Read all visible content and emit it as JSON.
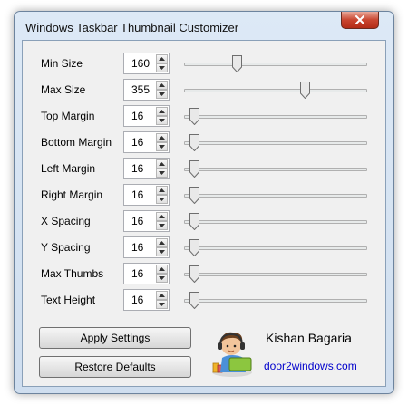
{
  "window": {
    "title": "Windows Taskbar Thumbnail Customizer"
  },
  "settings": [
    {
      "label": "Min Size",
      "value": "160",
      "slider_fraction": 0.28
    },
    {
      "label": "Max Size",
      "value": "355",
      "slider_fraction": 0.67
    },
    {
      "label": "Top Margin",
      "value": "16",
      "slider_fraction": 0.03
    },
    {
      "label": "Bottom Margin",
      "value": "16",
      "slider_fraction": 0.03
    },
    {
      "label": "Left Margin",
      "value": "16",
      "slider_fraction": 0.03
    },
    {
      "label": "Right Margin",
      "value": "16",
      "slider_fraction": 0.03
    },
    {
      "label": "X Spacing",
      "value": "16",
      "slider_fraction": 0.03
    },
    {
      "label": "Y Spacing",
      "value": "16",
      "slider_fraction": 0.03
    },
    {
      "label": "Max Thumbs",
      "value": "16",
      "slider_fraction": 0.03
    },
    {
      "label": "Text Height",
      "value": "16",
      "slider_fraction": 0.03
    }
  ],
  "buttons": {
    "apply": "Apply Settings",
    "restore": "Restore Defaults"
  },
  "author": {
    "name": "Kishan Bagaria",
    "link": "door2windows.com"
  },
  "icons": {
    "close": "close-icon",
    "avatar": "author-avatar-icon"
  },
  "colors": {
    "link": "#0000cc",
    "close": "#c9452f"
  }
}
